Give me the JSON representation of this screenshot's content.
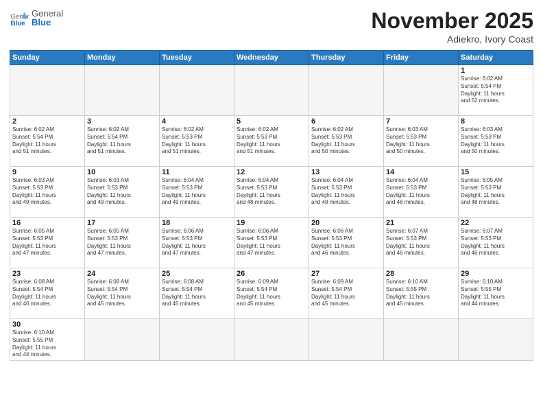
{
  "logo": {
    "general": "General",
    "blue": "Blue"
  },
  "title": "November 2025",
  "location": "Adiekro, Ivory Coast",
  "days_of_week": [
    "Sunday",
    "Monday",
    "Tuesday",
    "Wednesday",
    "Thursday",
    "Friday",
    "Saturday"
  ],
  "weeks": [
    [
      {
        "day": "",
        "info": ""
      },
      {
        "day": "",
        "info": ""
      },
      {
        "day": "",
        "info": ""
      },
      {
        "day": "",
        "info": ""
      },
      {
        "day": "",
        "info": ""
      },
      {
        "day": "",
        "info": ""
      },
      {
        "day": "1",
        "info": "Sunrise: 6:02 AM\nSunset: 5:54 PM\nDaylight: 11 hours\nand 52 minutes."
      }
    ],
    [
      {
        "day": "2",
        "info": "Sunrise: 6:02 AM\nSunset: 5:54 PM\nDaylight: 11 hours\nand 51 minutes."
      },
      {
        "day": "3",
        "info": "Sunrise: 6:02 AM\nSunset: 5:54 PM\nDaylight: 11 hours\nand 51 minutes."
      },
      {
        "day": "4",
        "info": "Sunrise: 6:02 AM\nSunset: 5:53 PM\nDaylight: 11 hours\nand 51 minutes."
      },
      {
        "day": "5",
        "info": "Sunrise: 6:02 AM\nSunset: 5:53 PM\nDaylight: 11 hours\nand 51 minutes."
      },
      {
        "day": "6",
        "info": "Sunrise: 6:02 AM\nSunset: 5:53 PM\nDaylight: 11 hours\nand 50 minutes."
      },
      {
        "day": "7",
        "info": "Sunrise: 6:03 AM\nSunset: 5:53 PM\nDaylight: 11 hours\nand 50 minutes."
      },
      {
        "day": "8",
        "info": "Sunrise: 6:03 AM\nSunset: 5:53 PM\nDaylight: 11 hours\nand 50 minutes."
      }
    ],
    [
      {
        "day": "9",
        "info": "Sunrise: 6:03 AM\nSunset: 5:53 PM\nDaylight: 11 hours\nand 49 minutes."
      },
      {
        "day": "10",
        "info": "Sunrise: 6:03 AM\nSunset: 5:53 PM\nDaylight: 11 hours\nand 49 minutes."
      },
      {
        "day": "11",
        "info": "Sunrise: 6:04 AM\nSunset: 5:53 PM\nDaylight: 11 hours\nand 49 minutes."
      },
      {
        "day": "12",
        "info": "Sunrise: 6:04 AM\nSunset: 5:53 PM\nDaylight: 11 hours\nand 48 minutes."
      },
      {
        "day": "13",
        "info": "Sunrise: 6:04 AM\nSunset: 5:53 PM\nDaylight: 11 hours\nand 48 minutes."
      },
      {
        "day": "14",
        "info": "Sunrise: 6:04 AM\nSunset: 5:53 PM\nDaylight: 11 hours\nand 48 minutes."
      },
      {
        "day": "15",
        "info": "Sunrise: 6:05 AM\nSunset: 5:53 PM\nDaylight: 11 hours\nand 48 minutes."
      }
    ],
    [
      {
        "day": "16",
        "info": "Sunrise: 6:05 AM\nSunset: 5:53 PM\nDaylight: 11 hours\nand 47 minutes."
      },
      {
        "day": "17",
        "info": "Sunrise: 6:05 AM\nSunset: 5:53 PM\nDaylight: 11 hours\nand 47 minutes."
      },
      {
        "day": "18",
        "info": "Sunrise: 6:06 AM\nSunset: 5:53 PM\nDaylight: 11 hours\nand 47 minutes."
      },
      {
        "day": "19",
        "info": "Sunrise: 6:06 AM\nSunset: 5:53 PM\nDaylight: 11 hours\nand 47 minutes."
      },
      {
        "day": "20",
        "info": "Sunrise: 6:06 AM\nSunset: 5:53 PM\nDaylight: 11 hours\nand 46 minutes."
      },
      {
        "day": "21",
        "info": "Sunrise: 6:07 AM\nSunset: 5:53 PM\nDaylight: 11 hours\nand 46 minutes."
      },
      {
        "day": "22",
        "info": "Sunrise: 6:07 AM\nSunset: 5:53 PM\nDaylight: 11 hours\nand 46 minutes."
      }
    ],
    [
      {
        "day": "23",
        "info": "Sunrise: 6:08 AM\nSunset: 5:54 PM\nDaylight: 11 hours\nand 46 minutes."
      },
      {
        "day": "24",
        "info": "Sunrise: 6:08 AM\nSunset: 5:54 PM\nDaylight: 11 hours\nand 45 minutes."
      },
      {
        "day": "25",
        "info": "Sunrise: 6:08 AM\nSunset: 5:54 PM\nDaylight: 11 hours\nand 45 minutes."
      },
      {
        "day": "26",
        "info": "Sunrise: 6:09 AM\nSunset: 5:54 PM\nDaylight: 11 hours\nand 45 minutes."
      },
      {
        "day": "27",
        "info": "Sunrise: 6:09 AM\nSunset: 5:54 PM\nDaylight: 11 hours\nand 45 minutes."
      },
      {
        "day": "28",
        "info": "Sunrise: 6:10 AM\nSunset: 5:55 PM\nDaylight: 11 hours\nand 45 minutes."
      },
      {
        "day": "29",
        "info": "Sunrise: 6:10 AM\nSunset: 5:55 PM\nDaylight: 11 hours\nand 44 minutes."
      }
    ],
    [
      {
        "day": "30",
        "info": "Sunrise: 6:10 AM\nSunset: 5:55 PM\nDaylight: 11 hours\nand 44 minutes."
      },
      {
        "day": "",
        "info": ""
      },
      {
        "day": "",
        "info": ""
      },
      {
        "day": "",
        "info": ""
      },
      {
        "day": "",
        "info": ""
      },
      {
        "day": "",
        "info": ""
      },
      {
        "day": "",
        "info": ""
      }
    ]
  ]
}
